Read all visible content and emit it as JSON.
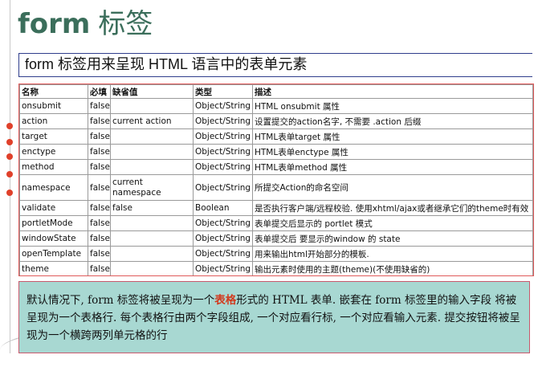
{
  "slide": {
    "title_en": "form",
    "title_cn": "标签",
    "subtitle": "form 标签用来呈现 HTML 语言中的表单元素"
  },
  "table": {
    "headers": [
      "名称",
      "必填",
      "缺省值",
      "类型",
      "描述"
    ],
    "rows": [
      [
        "onsubmit",
        "false",
        "",
        "Object/String",
        "HTML onsubmit 属性"
      ],
      [
        "action",
        "false",
        "current action",
        "Object/String",
        "设置提交的action名字, 不需要 .action 后缀"
      ],
      [
        "target",
        "false",
        "",
        "Object/String",
        "HTML表单target 属性"
      ],
      [
        "enctype",
        "false",
        "",
        "Object/String",
        "HTML表单enctype 属性"
      ],
      [
        "method",
        "false",
        "",
        "Object/String",
        "HTML表单method 属性"
      ],
      [
        "namespace",
        "false",
        "current namespace",
        "Object/String",
        "所提交Action的命名空间"
      ],
      [
        "validate",
        "false",
        "false",
        "Boolean",
        "是否执行客户端/远程校验. 使用xhtml/ajax或者继承它们的theme时有效"
      ],
      [
        "portletMode",
        "false",
        "",
        "Object/String",
        "表单提交后显示的 portlet 模式"
      ],
      [
        "windowState",
        "false",
        "",
        "Object/String",
        "表单提交后 要显示的window 的 state"
      ],
      [
        "openTemplate",
        "false",
        "",
        "Object/String",
        "用来输出html开始部分的模板."
      ],
      [
        "theme",
        "false",
        "",
        "Object/String",
        "输出元素时使用的主题(theme)(不使用缺省的)"
      ]
    ]
  },
  "note": {
    "before": "默认情况下, form 标签将被呈现为一个",
    "highlight": "表格",
    "after": "形式的 HTML 表单. 嵌套在 form 标签里的输入字段 将被呈现为一个表格行. 每个表格行由两个字段组成, 一个对应看行标, 一个对应看输入元素. 提交按钮将被呈现为一个横跨两列单元格的行"
  },
  "colors": {
    "title": "#3b6e5b",
    "subtitle_border": "#2f3e8c",
    "table_border": "#e05a5a",
    "bullet": "#e0402a",
    "note_bg": "#a8d8d2",
    "note_border": "#c95a6e",
    "note_highlight": "#d23a1e"
  }
}
